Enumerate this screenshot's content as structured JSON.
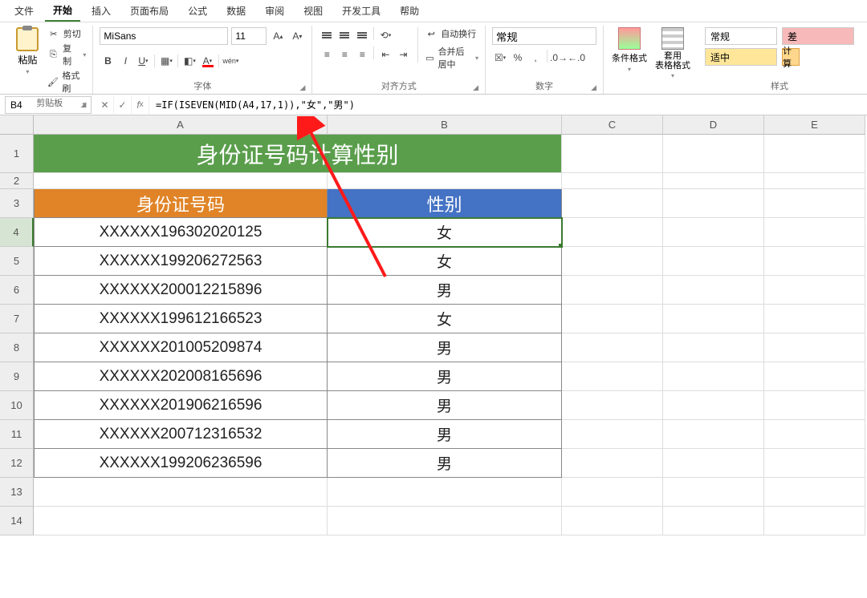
{
  "menu": {
    "items": [
      "文件",
      "开始",
      "插入",
      "页面布局",
      "公式",
      "数据",
      "审阅",
      "视图",
      "开发工具",
      "帮助"
    ],
    "active_index": 1
  },
  "ribbon": {
    "clipboard": {
      "paste": "粘贴",
      "cut": "剪切",
      "copy": "复制",
      "brush": "格式刷",
      "label": "剪贴板"
    },
    "font": {
      "family": "MiSans",
      "size": "11",
      "label": "字体",
      "wen": "wén"
    },
    "alignment": {
      "wrap": "自动换行",
      "merge": "合并后居中",
      "label": "对齐方式"
    },
    "number": {
      "format": "常规",
      "label": "数字"
    },
    "styles": {
      "cond": "条件格式",
      "table": "套用\n表格格式",
      "normal": "常规",
      "good": "适中",
      "bad": "差",
      "calc": "计算",
      "label": "样式"
    }
  },
  "formula_bar": {
    "name_box": "B4",
    "formula": "=IF(ISEVEN(MID(A4,17,1)),\"女\",\"男\")"
  },
  "grid": {
    "columns": [
      "A",
      "B",
      "C",
      "D",
      "E"
    ],
    "title": "身份证号码计算性别",
    "headers": {
      "id": "身份证号码",
      "gender": "性别"
    },
    "rows": [
      {
        "id": "XXXXXX196302020125",
        "gender": "女"
      },
      {
        "id": "XXXXXX199206272563",
        "gender": "女"
      },
      {
        "id": "XXXXXX200012215896",
        "gender": "男"
      },
      {
        "id": "XXXXXX199612166523",
        "gender": "女"
      },
      {
        "id": "XXXXXX201005209874",
        "gender": "男"
      },
      {
        "id": "XXXXXX202008165696",
        "gender": "男"
      },
      {
        "id": "XXXXXX201906216596",
        "gender": "男"
      },
      {
        "id": "XXXXXX200712316532",
        "gender": "男"
      },
      {
        "id": "XXXXXX199206236596",
        "gender": "男"
      }
    ]
  }
}
